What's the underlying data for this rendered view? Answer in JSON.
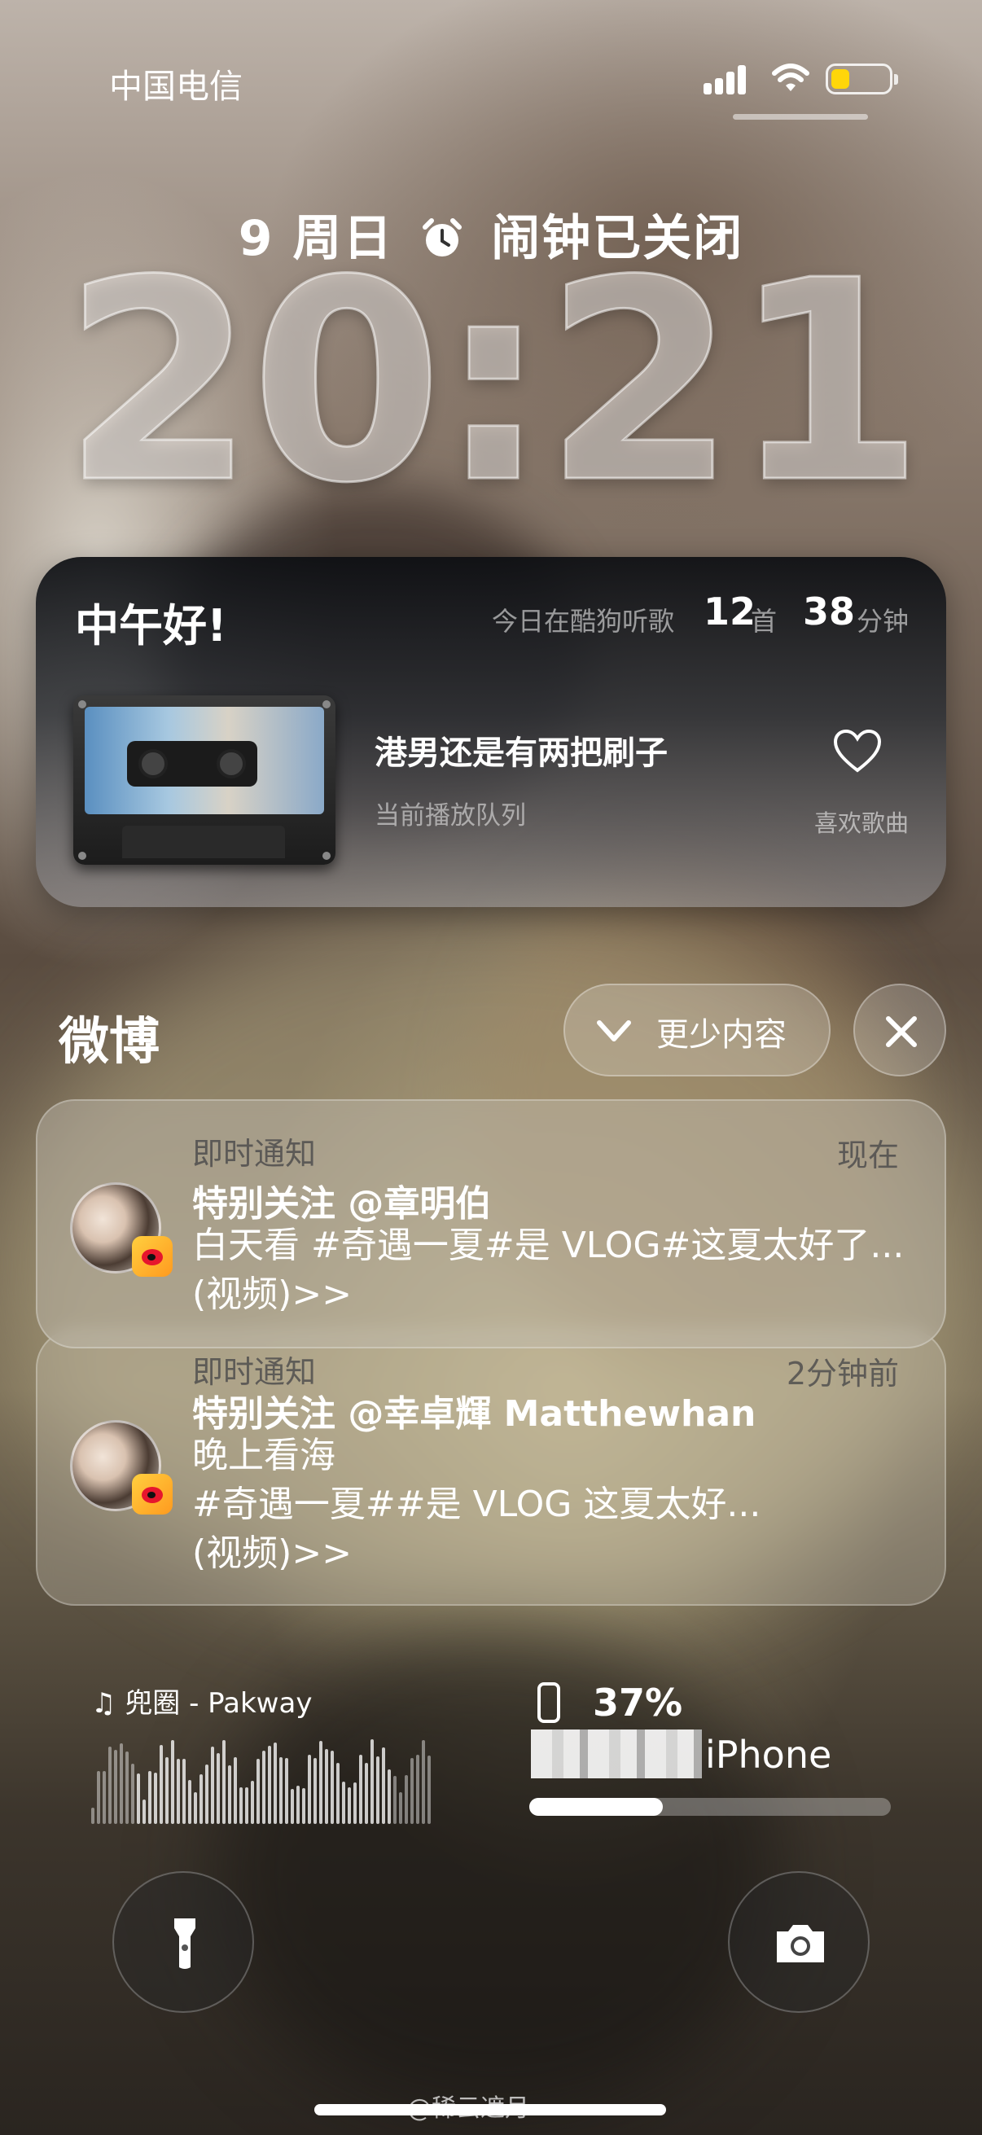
{
  "status_bar": {
    "carrier": "中国电信",
    "icons": [
      "cellular-signal-icon",
      "wifi-icon",
      "battery-icon"
    ],
    "battery_color": "#ffd60a"
  },
  "lockscreen": {
    "date_day": "9 周日",
    "alarm_icon": "alarm-clock-icon",
    "alarm_text": "闹钟已关闭",
    "time": "20:21"
  },
  "music_widget": {
    "greeting": "中午好!",
    "today_label": "今日在酷狗听歌",
    "songs_count": "12",
    "songs_unit": "首",
    "minutes_count": "38",
    "minutes_unit": "分钟",
    "song_title": "港男还是有两把刷子",
    "queue_label": "当前播放队列",
    "like_label": "喜欢歌曲",
    "like_icon": "heart-icon"
  },
  "notification_group": {
    "app_name": "微博",
    "show_less_label": "更少内容",
    "notifications": [
      {
        "type": "即时通知",
        "time": "现在",
        "title": "特别关注 @章明伯",
        "body": "白天看 #奇遇一夏#是 VLOG#这夏太好了...(视频)>>"
      },
      {
        "type": "即时通知",
        "time": "2分钟前",
        "title": "特别关注 @幸卓輝 Matthewhan",
        "body_line1": "晚上看海",
        "body_line2": " #奇遇一夏##是 VLOG 这夏太好...",
        "body_line3": "(视频)>>"
      }
    ]
  },
  "now_playing": {
    "icon": "music-note-icon",
    "text": "兜圈 - Pakway"
  },
  "battery_widget": {
    "percent": "37%",
    "level": 0.37,
    "device_name": "iPhone"
  },
  "bottom_controls": {
    "flashlight_icon": "flashlight-icon",
    "camera_icon": "camera-icon"
  },
  "watermark": "@稀云遮月"
}
